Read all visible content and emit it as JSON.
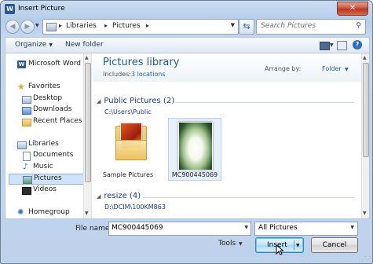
{
  "window": {
    "title": "Insert Picture",
    "close_glyph": "✕",
    "app_icon_letter": "W"
  },
  "address": {
    "crumbs": [
      "Libraries",
      "Pictures"
    ],
    "separator": "▸",
    "search_placeholder": "Search Pictures"
  },
  "toolbar": {
    "organize_label": "Organize",
    "new_folder_label": "New folder",
    "help_glyph": "?"
  },
  "nav": {
    "items": [
      {
        "label": "Microsoft Word",
        "icon": "word-icon"
      },
      {
        "label": "Favorites",
        "icon": "star-icon"
      },
      {
        "label": "Desktop",
        "icon": "desktop-folder-icon"
      },
      {
        "label": "Downloads",
        "icon": "downloads-folder-icon"
      },
      {
        "label": "Recent Places",
        "icon": "recent-places-icon"
      },
      {
        "label": "Libraries",
        "icon": "libraries-icon"
      },
      {
        "label": "Documents",
        "icon": "documents-icon"
      },
      {
        "label": "Music",
        "icon": "music-icon"
      },
      {
        "label": "Pictures",
        "icon": "pictures-icon",
        "selected": true
      },
      {
        "label": "Videos",
        "icon": "videos-icon"
      },
      {
        "label": "Homegroup",
        "icon": "homegroup-icon"
      }
    ]
  },
  "library": {
    "title": "Pictures library",
    "includes_label": "Includes:",
    "locations_link": "3 locations",
    "arrange_label": "Arrange by:",
    "arrange_value": "Folder"
  },
  "groups": [
    {
      "name": "Public Pictures (2)",
      "path": "C:\\Users\\Public",
      "files": [
        {
          "name": "Sample Pictures",
          "kind": "folder"
        },
        {
          "name": "MC900445069",
          "kind": "image",
          "selected": true
        }
      ]
    },
    {
      "name": "resize (4)",
      "path": "D:\\DCIM\\100KM863",
      "files": []
    }
  ],
  "footer": {
    "filename_label": "File name:",
    "filename_value": "MC900445069",
    "filter_value": "All Pictures",
    "tools_label": "Tools",
    "insert_label": "Insert",
    "cancel_label": "Cancel"
  },
  "colors": {
    "accent_blue": "#1f62b5",
    "library_title": "#1e5e8a",
    "selection": "#cfe3fb",
    "close_red": "#c6503c"
  }
}
